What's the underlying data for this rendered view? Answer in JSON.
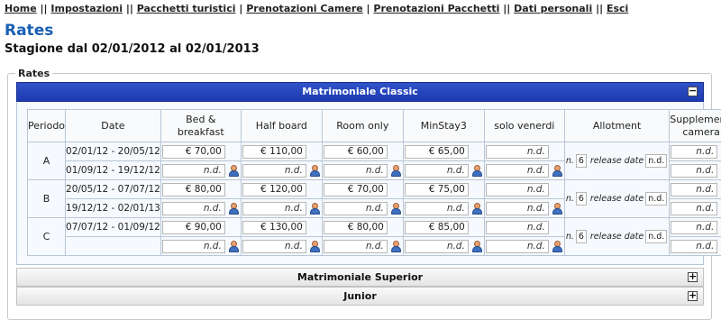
{
  "nav": [
    "Home",
    "Impostazioni",
    "Pacchetti turistici",
    "Prenotazioni Camere",
    "Prenotazioni Pacchetti",
    "Dati personali",
    "Esci"
  ],
  "separators": [
    "||",
    "||",
    "|",
    "|",
    "||",
    "||"
  ],
  "page": {
    "title": "Rates",
    "season": "Stagione dal 02/01/2012 al 02/01/2013"
  },
  "fieldset_legend": "Rates",
  "accordion": [
    {
      "title": "Matrimoniale Classic",
      "toggle": "−"
    },
    {
      "title": "Matrimoniale Superior",
      "toggle": "+"
    },
    {
      "title": "Junior",
      "toggle": "+"
    }
  ],
  "columns": [
    "Periodo",
    "Date",
    "Bed & breakfast",
    "Half board",
    "Room only",
    "MinStay3",
    "solo venerdi",
    "Allotment",
    "Supplementi camera"
  ],
  "allotment_labels": {
    "n": "n.",
    "release": "release date"
  },
  "rows": [
    {
      "periodo": "A",
      "dates": [
        "02/01/12 - 20/05/12",
        "01/09/12 - 19/12/12"
      ],
      "bb": "€ 70,00",
      "hb": "€ 110,00",
      "ro": "€ 60,00",
      "ms": "€ 65,00",
      "sv": "n.d.",
      "allot_n": "6",
      "allot_release": "n.d.",
      "suppl": "n.d.",
      "sub": "n.d."
    },
    {
      "periodo": "B",
      "dates": [
        "20/05/12 - 07/07/12",
        "19/12/12 - 02/01/13"
      ],
      "bb": "€ 80,00",
      "hb": "€ 120,00",
      "ro": "€ 70,00",
      "ms": "€ 75,00",
      "sv": "n.d.",
      "allot_n": "6",
      "allot_release": "n.d.",
      "suppl": "n.d.",
      "sub": "n.d."
    },
    {
      "periodo": "C",
      "dates": [
        "07/07/12 - 01/09/12",
        ""
      ],
      "bb": "€ 90,00",
      "hb": "€ 130,00",
      "ro": "€ 80,00",
      "ms": "€ 85,00",
      "sv": "n.d.",
      "allot_n": "6",
      "allot_release": "n.d.",
      "suppl": "n.d.",
      "sub": "n.d."
    }
  ]
}
